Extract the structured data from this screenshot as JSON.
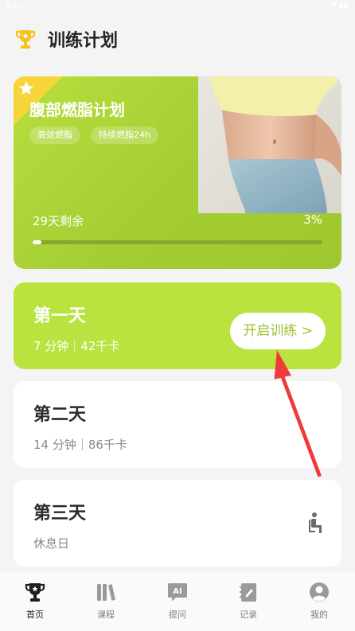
{
  "status_bar": {
    "time": "4:31",
    "icons": "▼◢▮"
  },
  "header": {
    "title": "训练计划"
  },
  "plan": {
    "title": "腹部燃脂计划",
    "tags": [
      "高效燃脂",
      "持续燃脂24h"
    ],
    "remaining": "29天剩余",
    "percent": "3%",
    "progress_fraction": 0.03
  },
  "days": [
    {
      "title": "第一天",
      "sub": "7 分钟｜42千卡",
      "button": "开启训练 >"
    },
    {
      "title": "第二天",
      "sub": "14 分钟｜86千卡"
    },
    {
      "title": "第三天",
      "sub": "休息日"
    }
  ],
  "tabs": [
    {
      "label": "首页",
      "icon": "trophy-icon",
      "active": true
    },
    {
      "label": "课程",
      "icon": "books-icon",
      "active": false
    },
    {
      "label": "提问",
      "icon": "ai-icon",
      "active": false
    },
    {
      "label": "记录",
      "icon": "notebook-icon",
      "active": false
    },
    {
      "label": "我的",
      "icon": "user-icon",
      "active": false
    }
  ],
  "colors": {
    "accent": "#b9e33f",
    "arrow": "#f03a3a",
    "trophy": "#f7c21b"
  }
}
